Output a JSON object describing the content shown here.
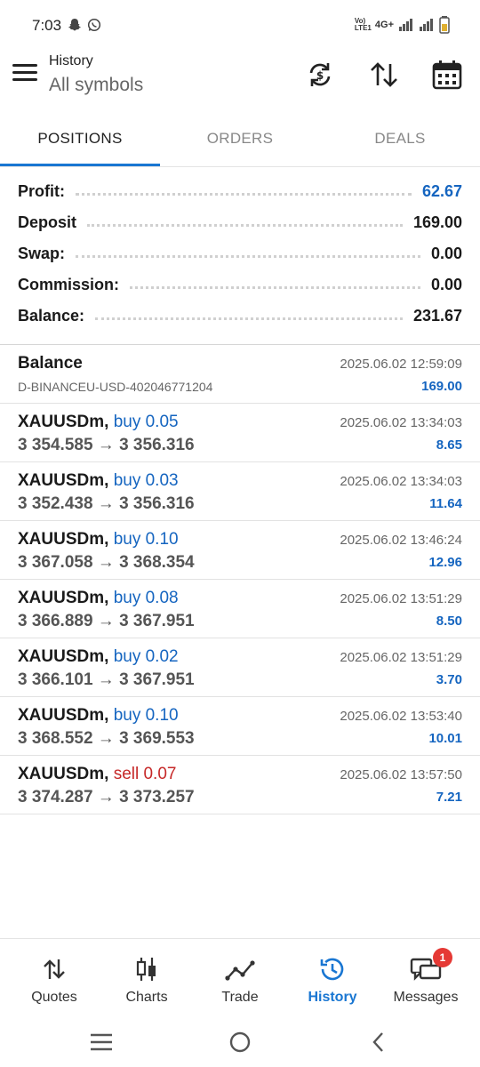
{
  "status": {
    "time": "7:03",
    "network": "4G+",
    "volte": "Vo) LTE1"
  },
  "header": {
    "title": "History",
    "subtitle": "All symbols",
    "icons": [
      "menu-icon",
      "sync-icon",
      "sort-icon",
      "calendar-icon"
    ]
  },
  "tabs": [
    {
      "label": "POSITIONS",
      "active": true
    },
    {
      "label": "ORDERS",
      "active": false
    },
    {
      "label": "DEALS",
      "active": false
    }
  ],
  "summary": [
    {
      "label": "Profit:",
      "value": "62.67",
      "color": "#1565c0"
    },
    {
      "label": "Deposit",
      "value": "169.00",
      "color": "#1a1a1a"
    },
    {
      "label": "Swap:",
      "value": "0.00",
      "color": "#1a1a1a"
    },
    {
      "label": "Commission:",
      "value": "0.00",
      "color": "#1a1a1a"
    },
    {
      "label": "Balance:",
      "value": "231.67",
      "color": "#1a1a1a"
    }
  ],
  "balance_entry": {
    "title": "Balance",
    "account": "D-BINANCEU-USD-402046771204",
    "time": "2025.06.02 12:59:09",
    "amount": "169.00"
  },
  "deals": [
    {
      "symbol": "XAUUSDm,",
      "side": "buy",
      "volume": "0.05",
      "prices": "3 354.585 → 3 356.316",
      "time": "2025.06.02 13:34:03",
      "profit": "8.65"
    },
    {
      "symbol": "XAUUSDm,",
      "side": "buy",
      "volume": "0.03",
      "prices": "3 352.438 → 3 356.316",
      "time": "2025.06.02 13:34:03",
      "profit": "11.64"
    },
    {
      "symbol": "XAUUSDm,",
      "side": "buy",
      "volume": "0.10",
      "prices": "3 367.058 → 3 368.354",
      "time": "2025.06.02 13:46:24",
      "profit": "12.96"
    },
    {
      "symbol": "XAUUSDm,",
      "side": "buy",
      "volume": "0.08",
      "prices": "3 366.889 → 3 367.951",
      "time": "2025.06.02 13:51:29",
      "profit": "8.50"
    },
    {
      "symbol": "XAUUSDm,",
      "side": "buy",
      "volume": "0.02",
      "prices": "3 366.101 → 3 367.951",
      "time": "2025.06.02 13:51:29",
      "profit": "3.70"
    },
    {
      "symbol": "XAUUSDm,",
      "side": "buy",
      "volume": "0.10",
      "prices": "3 368.552 → 3 369.553",
      "time": "2025.06.02 13:53:40",
      "profit": "10.01"
    },
    {
      "symbol": "XAUUSDm,",
      "side": "sell",
      "volume": "0.07",
      "prices": "3 374.287 → 3 373.257",
      "time": "2025.06.02 13:57:50",
      "profit": "7.21"
    }
  ],
  "bottom_nav": [
    {
      "label": "Quotes",
      "icon": "quotes-icon",
      "active": false
    },
    {
      "label": "Charts",
      "icon": "charts-icon",
      "active": false
    },
    {
      "label": "Trade",
      "icon": "trade-icon",
      "active": false
    },
    {
      "label": "History",
      "icon": "history-icon",
      "active": true
    },
    {
      "label": "Messages",
      "icon": "messages-icon",
      "active": false,
      "badge": "1"
    }
  ],
  "colors": {
    "accent": "#1976d2",
    "profit_blue": "#1565c0",
    "sell_red": "#c62828",
    "badge_red": "#e53935"
  }
}
